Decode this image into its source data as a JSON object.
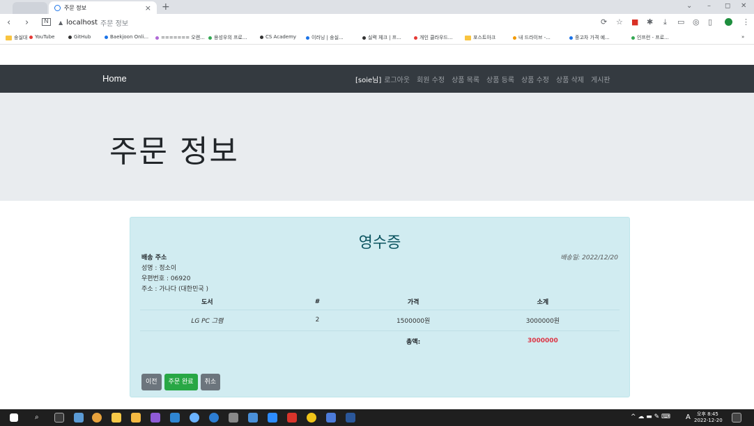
{
  "browser": {
    "tab_title": "주문 정보",
    "ghost_tab": "»",
    "address_host": "localhost",
    "address_path": "주문 정보",
    "bookmarks": [
      {
        "label": "숭실대",
        "icon": "folder"
      },
      {
        "label": "YouTube",
        "icon": "red"
      },
      {
        "label": "GitHub",
        "icon": "dark"
      },
      {
        "label": "Baekjoon Onli...",
        "icon": "blue"
      },
      {
        "label": "======= 오렌...",
        "icon": "purple"
      },
      {
        "label": "용성우의 프로...",
        "icon": "green"
      },
      {
        "label": "CS Academy",
        "icon": "dark"
      },
      {
        "label": "이러닝 | 숭실...",
        "icon": "blue"
      },
      {
        "label": "실력 체크 | 프...",
        "icon": "dark"
      },
      {
        "label": "개인 클라우드...",
        "icon": "red"
      },
      {
        "label": "포스트아크",
        "icon": "folder"
      },
      {
        "label": "내 드라이브 -...",
        "icon": "orange"
      },
      {
        "label": "중고차 가격 예...",
        "icon": "blue"
      },
      {
        "label": "인프런 - 프로...",
        "icon": "green"
      }
    ],
    "bookmarks_more": "»"
  },
  "navbar": {
    "brand": "Home",
    "user": "[soie님]",
    "links": [
      "로그아웃",
      "회원 수정",
      "상품 목록",
      "상품 등록",
      "상품 수정",
      "상품 삭제",
      "게시판"
    ]
  },
  "jumbotron": {
    "title": "주문 정보"
  },
  "receipt": {
    "title": "영수증",
    "address_heading": "배송 주소",
    "name_line": "성명 : 정소이",
    "zip_line": "우편번호 : 06920",
    "addr_line": "주소 : 가나다 (대한민국 )",
    "ship_date": "배송일: 2022/12/20",
    "columns": [
      "도서",
      "#",
      "가격",
      "소계"
    ],
    "rows": [
      {
        "name": "LG PC 그램",
        "qty": "2",
        "price": "1500000원",
        "subtotal": "3000000원"
      }
    ],
    "total_label": "총액:",
    "total_value": "3000000",
    "buttons": {
      "prev": "이전",
      "complete": "주문 완료",
      "cancel": "취소"
    }
  },
  "taskbar": {
    "time": "오후 8:45",
    "date": "2022-12-20",
    "ime": "A"
  },
  "colors": {
    "navbar": "#343a40",
    "jumbotron": "#e9ecef",
    "receipt_bg": "#d1ecf1",
    "total": "#dc3545",
    "complete_btn": "#28a745"
  }
}
